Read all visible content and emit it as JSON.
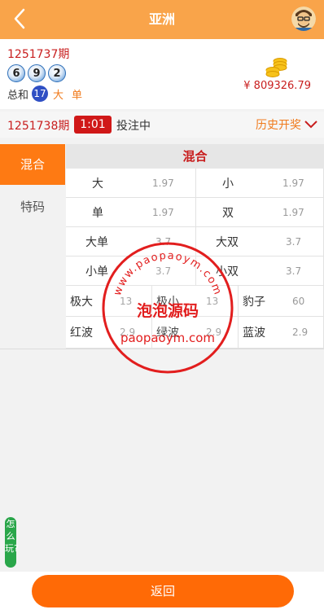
{
  "header": {
    "title": "亚洲"
  },
  "last_draw": {
    "issue": "1251737期",
    "balls": [
      "6",
      "9",
      "2"
    ],
    "sum_label": "总和",
    "sum_value": "17",
    "tags": [
      "大",
      "单"
    ]
  },
  "balance": "¥ 809326.79",
  "bet_bar": {
    "issue": "1251738期",
    "timer": "1:01",
    "status": "投注中",
    "history_label": "历史开奖"
  },
  "sidebar": [
    {
      "label": "混合",
      "active": true
    },
    {
      "label": "特码",
      "active": false
    }
  ],
  "content_title": "混合",
  "options_row1": [
    {
      "name": "大",
      "odds": "1.97"
    },
    {
      "name": "小",
      "odds": "1.97"
    },
    {
      "name": "单",
      "odds": "1.97"
    },
    {
      "name": "双",
      "odds": "1.97"
    },
    {
      "name": "大单",
      "odds": "3.7"
    },
    {
      "name": "大双",
      "odds": "3.7"
    },
    {
      "name": "小单",
      "odds": "3.7"
    },
    {
      "name": "小双",
      "odds": "3.7"
    }
  ],
  "options_row2": [
    {
      "name": "极大",
      "odds": "13"
    },
    {
      "name": "极小",
      "odds": "13"
    },
    {
      "name": "豹子",
      "odds": "60"
    },
    {
      "name": "红波",
      "odds": "2.9"
    },
    {
      "name": "绿波",
      "odds": "2.9"
    },
    {
      "name": "蓝波",
      "odds": "2.9"
    }
  ],
  "watermark": {
    "url_top": "www.paopaoym.com",
    "name": "泡泡源码",
    "url_bottom": "paopaoym.com"
  },
  "howto_label": "怎么玩?",
  "footer": {
    "return_label": "返回"
  },
  "colors": {
    "header": "#f9a44a",
    "accent": "#fe7a13",
    "red": "#c81e1e",
    "howto": "#2aa64a"
  }
}
